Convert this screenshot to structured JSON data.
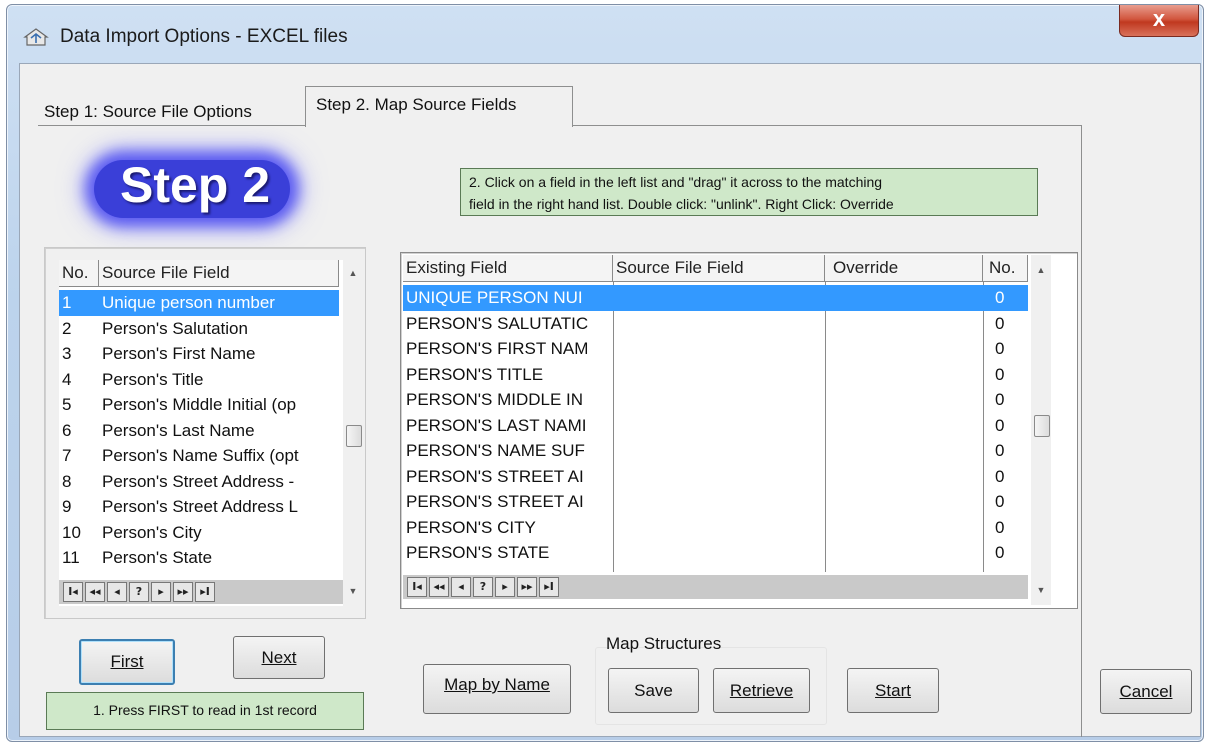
{
  "window": {
    "title": "Data Import Options - EXCEL files",
    "close_glyph": "x"
  },
  "tabs": [
    {
      "label": "Step 1: Source File Options",
      "active": false
    },
    {
      "label": "Step 2. Map Source Fields",
      "active": true
    }
  ],
  "step_logo": "Step 2",
  "instructions": {
    "drag_line1": "2.  Click on a field in the left list and \"drag\" it across to the matching",
    "drag_line2": "field in the right hand list.  Double click: \"unlink\". Right Click: Override",
    "first_hint": "1. Press FIRST to read in 1st record"
  },
  "source_grid": {
    "headers": [
      "No.",
      "Source File Field"
    ],
    "rows": [
      {
        "no": "1",
        "field": "Unique person number",
        "selected": true
      },
      {
        "no": "2",
        "field": "Person's Salutation"
      },
      {
        "no": "3",
        "field": "Person's First Name"
      },
      {
        "no": "4",
        "field": "Person's Title"
      },
      {
        "no": "5",
        "field": "Person's Middle Initial (op"
      },
      {
        "no": "6",
        "field": "Person's Last Name"
      },
      {
        "no": "7",
        "field": "Person's Name Suffix (opt"
      },
      {
        "no": "8",
        "field": "Person's Street Address -"
      },
      {
        "no": "9",
        "field": "Person's Street Address L"
      },
      {
        "no": "10",
        "field": "Person's City"
      },
      {
        "no": "11",
        "field": "Person's State"
      }
    ]
  },
  "mapping_grid": {
    "headers": [
      "Existing Field",
      "Source File Field",
      "Override",
      "No."
    ],
    "rows": [
      {
        "existing": "UNIQUE PERSON NUI",
        "source": "",
        "override": "",
        "no": "0",
        "selected": true
      },
      {
        "existing": "PERSON'S SALUTATIC",
        "source": "",
        "override": "",
        "no": "0"
      },
      {
        "existing": "PERSON'S FIRST NAM",
        "source": "",
        "override": "",
        "no": "0"
      },
      {
        "existing": "PERSON'S TITLE",
        "source": "",
        "override": "",
        "no": "0"
      },
      {
        "existing": "PERSON'S MIDDLE IN",
        "source": "",
        "override": "",
        "no": "0"
      },
      {
        "existing": "PERSON'S LAST NAMI",
        "source": "",
        "override": "",
        "no": "0"
      },
      {
        "existing": "PERSON'S NAME SUF",
        "source": "",
        "override": "",
        "no": "0"
      },
      {
        "existing": "PERSON'S STREET AI",
        "source": "",
        "override": "",
        "no": "0"
      },
      {
        "existing": "PERSON'S STREET AI",
        "source": "",
        "override": "",
        "no": "0"
      },
      {
        "existing": "PERSON'S CITY",
        "source": "",
        "override": "",
        "no": "0"
      },
      {
        "existing": "PERSON'S STATE",
        "source": "",
        "override": "",
        "no": "0"
      }
    ]
  },
  "navigator": [
    "I◂",
    "◂◂",
    "◂",
    "?",
    "▸",
    "▸▸",
    "▸I"
  ],
  "buttons": {
    "first": "First",
    "next": "Next",
    "map_by_name": "Map by Name",
    "map_structures_label": "Map Structures",
    "save": "Save",
    "retrieve": "Retrieve",
    "start": "Start",
    "cancel": "Cancel"
  },
  "colors": {
    "selection": "#3399ff",
    "instruction_bg": "#cfe8c9",
    "logo_blue": "#3a3fd8"
  }
}
